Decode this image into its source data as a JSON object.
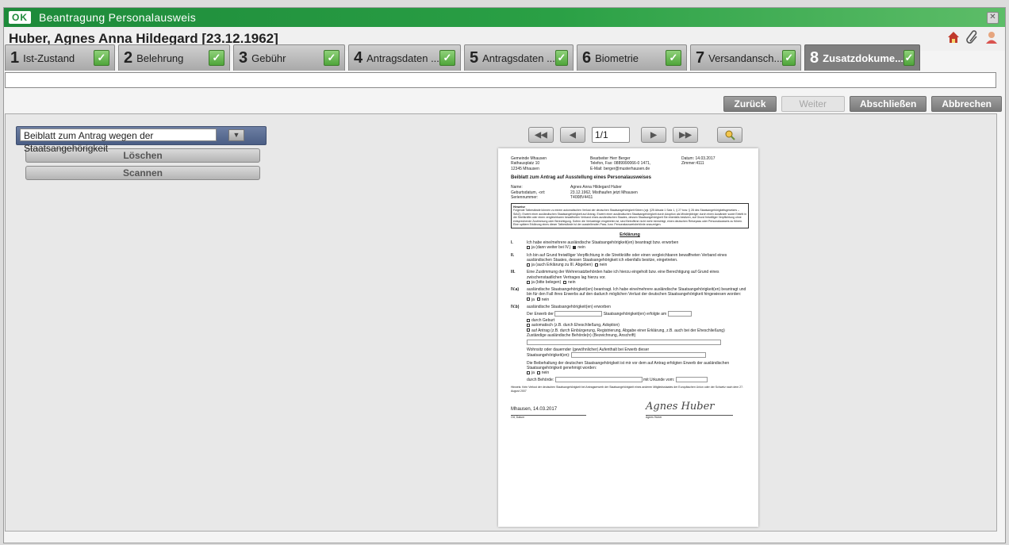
{
  "app": {
    "logo": "OK",
    "title": "Beantragung Personalausweis"
  },
  "header": {
    "person": "Huber, Agnes Anna Hildegard [23.12.1962]"
  },
  "tabs": [
    {
      "num": "1",
      "label": "Ist-Zustand"
    },
    {
      "num": "2",
      "label": "Belehrung"
    },
    {
      "num": "3",
      "label": "Gebühr"
    },
    {
      "num": "4",
      "label": "Antragsdaten ..."
    },
    {
      "num": "5",
      "label": "Antragsdaten ..."
    },
    {
      "num": "6",
      "label": "Biometrie"
    },
    {
      "num": "7",
      "label": "Versandansch..."
    },
    {
      "num": "8",
      "label": "Zusatzdokume..."
    }
  ],
  "actions": {
    "back": "Zurück",
    "next": "Weiter",
    "finish": "Abschließen",
    "cancel": "Abbrechen"
  },
  "left": {
    "dropdown_value": "Beiblatt zum Antrag wegen der Staatsangehörigkeit",
    "delete": "Löschen",
    "scan": "Scannen"
  },
  "pager": {
    "page": "1/1"
  },
  "document": {
    "addr1": "Gemeinde Mhausen",
    "addr2": "Rathausplatz 10",
    "addr3": "12345 Mhausen",
    "clerk": "Bearbeiter   Herr Berger",
    "phone": "Telefon, Fax: 0889990066-0 1471,",
    "email": "E-Mail:   berger@musterhausen.de",
    "date": "Datum: 14.03.2017",
    "room": "Zimmer:4111",
    "title": "Beiblatt zum Antrag auf Ausstellung eines Personalausweises",
    "name_k": "Name:",
    "name_v": "Agnes Anna Hildegard Huber",
    "birth_k": "Geburtsdatum, -ort:",
    "birth_v": "23.12.1962, Misthaufen jetzt Mhausen",
    "serial_k": "Seriennummer:",
    "serial_v": "T4008V4411",
    "notice_title": "Hinweise",
    "notice_text": "Folgende Tatbestände können zu einem automatischen Verlust der deutschen Staatsangehörigkeit führen (vgl. §25 Absatz 1 Satz 1, § 27 bzw. § 28 des Staatsangehörigkeitsgesetzes – StAG): Erwerb einer ausländischen Staatsangehörigkeit auf Antrag. Erwerb einer ausländischen Staatsangehörigkeit durch Adoption als Minderjähriger durch einen Ausländer sowie Eintritt in die Streitkräfte oder einen vergleichbaren bewaffneten Verband eines ausländischen Staates, dessen Staatsangehörigkeit Sie ebenfalls besitzen, auf Grund freiwilliger Verpflichtung ohne entsprechende Zustimmung oder Berechtigung. Sofern die Verlustfolge eingetreten ist, sind Betroffene nicht mehr berechtigt, einen deutschen Reisepass oder Personalausweis zu führen. Eine spätere Erklärung eines dieser Tatbestände ist der ausstellenden Pass- bzw. Personalausweisbehörde anzuzeigen.",
    "decl_title": "Erklärung",
    "s1_n": "I.",
    "s1_t": "Ich habe eine/mehrere ausländische Staatsangehörigkeit(en) beantragt bzw. erworben",
    "s1_o1": "ja (dann weiter bei IV.)",
    "s1_o2": "nein",
    "s2_n": "II.",
    "s2_t": "Ich bin auf Grund freiwilliger Verpflichtung in die Streitkräfte oder einen vergleichbaren bewaffneten Verband eines ausländischen Staates, dessen Staatsangehörigkeit ich ebenfalls besitze, eingetreten.",
    "s2_o1": "ja (auch Erklärung zu III. Abgeben)",
    "s2_o2": "nein",
    "s3_n": "III.",
    "s3_t": "Eine Zustimmung der Wehrersatzbehörden habe ich hierzu eingeholt bzw. eine Berechtigung auf Grund eines zwischenstaatlichen Vertrages lag hierzu vor.",
    "s3_o1": "ja (bitte belegen)",
    "s3_o2": "nein",
    "s4a_n": "IV.a)",
    "s4a_t": "ausländische Staatsangehörigkeit(en) beantragt. Ich habe eine/mehrere ausländische Staatsangehörigkeit(en) beantragt und bin für den Fall ihres Erwerbs auf den dadurch möglichen Verlust der deutschen Staatsangehörigkeit hingewiesen worden:",
    "s4a_o1": "ja",
    "s4a_o2": "nein",
    "s4b_n": "IV.b)",
    "s4b_t": "ausländische Staatsangehörigkeit(en) erworben",
    "s4b_erwerb1": "Der Erwerb der",
    "s4b_erwerb2": "Staatsangehörigkeit(en) erfolgte am",
    "s4b_o1": "durch Geburt",
    "s4b_o2": "automatisch (z.B. durch Eheschließung, Adoption)",
    "s4b_o3": "auf Antrag (z.B. durch Einbürgerung, Registrierung, Abgabe einer Erklärung, z.B. auch bei der Eheschließung)",
    "s4b_auth": "Zuständige ausländische Behörde(n) (Bezeichnung, Anschrift)",
    "s4b_res": "Wohnsitz oder dauernder (gewöhnlicher) Aufenthalt bei Erwerb dieser",
    "s4b_sta": "Staatsangehörigkeit(en):",
    "s4b_keep": "Die Beibehaltung der deutschen Staatsangehörigkeit ist mir vor dem auf Antrag erfolgten Erwerb der ausländischen Staatsangehörigkeit genehmigt worden:",
    "s4b_k1": "ja",
    "s4b_k2": "nein",
    "s4b_by": "durch Behörde:",
    "s4b_doc": "mit Urkunde vom:",
    "footnote": "Hinweis: Kein Verlust der deutschen Staatsangehörigkeit bei Antragserwerb der Staatsangehörigkeit eines anderen Mitgliedsstaates der Europäischen Union oder der Schweiz nach dem 27. August 2007",
    "place_date": "Mhausen, 14.03.2017",
    "signature": "Agnes Huber",
    "sig_left": "Ort, Datum",
    "sig_right": "Agnes Huber"
  }
}
